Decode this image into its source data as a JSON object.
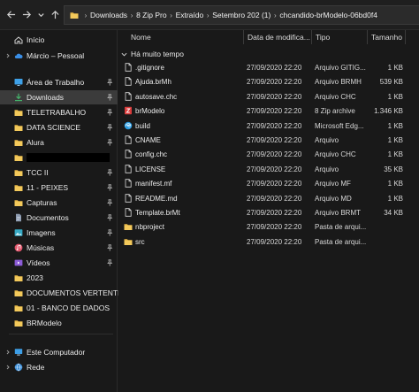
{
  "address": {
    "crumbs": [
      "Downloads",
      "8 Zip Pro",
      "Extraído",
      "Setembro 202 (1)",
      "chcandido-brModelo-06bd0f4"
    ]
  },
  "sidebar": {
    "items": [
      {
        "label": "Início",
        "icon": "home-icon",
        "chevron": false,
        "pinned": false
      },
      {
        "label": "Márcio – Pessoal",
        "icon": "cloud-icon",
        "chevron": true,
        "pinned": false
      },
      {
        "label": "Área de Trabalho",
        "icon": "desktop-icon",
        "chevron": false,
        "pinned": true
      },
      {
        "label": "Downloads",
        "icon": "download-icon",
        "chevron": false,
        "pinned": true
      },
      {
        "label": "TELETRABALHO",
        "icon": "folder-icon",
        "chevron": false,
        "pinned": true
      },
      {
        "label": "DATA SCIENCE",
        "icon": "folder-icon",
        "chevron": false,
        "pinned": true
      },
      {
        "label": "Alura",
        "icon": "folder-icon",
        "chevron": false,
        "pinned": true
      },
      {
        "label": "",
        "icon": "folder-icon",
        "chevron": false,
        "pinned": false
      },
      {
        "label": "TCC II",
        "icon": "folder-icon",
        "chevron": false,
        "pinned": true
      },
      {
        "label": "11 - PEIXES",
        "icon": "folder-icon",
        "chevron": false,
        "pinned": true
      },
      {
        "label": "Capturas",
        "icon": "folder-icon",
        "chevron": false,
        "pinned": true
      },
      {
        "label": "Documentos",
        "icon": "documents-icon",
        "chevron": false,
        "pinned": true
      },
      {
        "label": "Imagens",
        "icon": "images-icon",
        "chevron": false,
        "pinned": true
      },
      {
        "label": "Músicas",
        "icon": "music-icon",
        "chevron": false,
        "pinned": true
      },
      {
        "label": "Vídeos",
        "icon": "videos-icon",
        "chevron": false,
        "pinned": true
      },
      {
        "label": "2023",
        "icon": "folder-icon",
        "chevron": false,
        "pinned": false
      },
      {
        "label": "DOCUMENTOS VERTENTES",
        "icon": "folder-icon",
        "chevron": false,
        "pinned": false
      },
      {
        "label": "01 - BANCO DE DADOS",
        "icon": "folder-icon",
        "chevron": false,
        "pinned": false
      },
      {
        "label": "BRModelo",
        "icon": "folder-icon",
        "chevron": false,
        "pinned": false
      }
    ],
    "bottom": [
      {
        "label": "Este Computador",
        "icon": "computer-icon"
      },
      {
        "label": "Rede",
        "icon": "network-icon"
      }
    ]
  },
  "columns": {
    "name": "Nome",
    "date": "Data de modifica...",
    "type": "Tipo",
    "size": "Tamanho"
  },
  "group_label": "Há muito tempo",
  "files": [
    {
      "name": ".gitignore",
      "date": "27/09/2020 22:20",
      "type": "Arquivo GITIG...",
      "size": "1 KB",
      "icon": "file-icon"
    },
    {
      "name": "Ajuda.brMh",
      "date": "27/09/2020 22:20",
      "type": "Arquivo BRMH",
      "size": "539 KB",
      "icon": "file-icon"
    },
    {
      "name": "autosave.chc",
      "date": "27/09/2020 22:20",
      "type": "Arquivo CHC",
      "size": "1 KB",
      "icon": "file-icon"
    },
    {
      "name": "brModelo",
      "date": "27/09/2020 22:20",
      "type": "8 Zip archive",
      "size": "1.346 KB",
      "icon": "zip-icon"
    },
    {
      "name": "build",
      "date": "27/09/2020 22:20",
      "type": "Microsoft Edg...",
      "size": "1 KB",
      "icon": "edge-icon"
    },
    {
      "name": "CNAME",
      "date": "27/09/2020 22:20",
      "type": "Arquivo",
      "size": "1 KB",
      "icon": "file-icon"
    },
    {
      "name": "config.chc",
      "date": "27/09/2020 22:20",
      "type": "Arquivo CHC",
      "size": "1 KB",
      "icon": "file-icon"
    },
    {
      "name": "LICENSE",
      "date": "27/09/2020 22:20",
      "type": "Arquivo",
      "size": "35 KB",
      "icon": "file-icon"
    },
    {
      "name": "manifest.mf",
      "date": "27/09/2020 22:20",
      "type": "Arquivo MF",
      "size": "1 KB",
      "icon": "file-icon"
    },
    {
      "name": "README.md",
      "date": "27/09/2020 22:20",
      "type": "Arquivo MD",
      "size": "1 KB",
      "icon": "file-icon"
    },
    {
      "name": "Template.brMt",
      "date": "27/09/2020 22:20",
      "type": "Arquivo BRMT",
      "size": "34 KB",
      "icon": "file-icon"
    },
    {
      "name": "nbproject",
      "date": "27/09/2020 22:20",
      "type": "Pasta de arqui...",
      "size": "",
      "icon": "folder-icon"
    },
    {
      "name": "src",
      "date": "27/09/2020 22:20",
      "type": "Pasta de arqui...",
      "size": "",
      "icon": "folder-icon"
    }
  ],
  "colors": {
    "folder": "#e9b949",
    "accent": "#4ea1f3",
    "zip": "#d93b3b",
    "edge": "#2b9be0"
  }
}
